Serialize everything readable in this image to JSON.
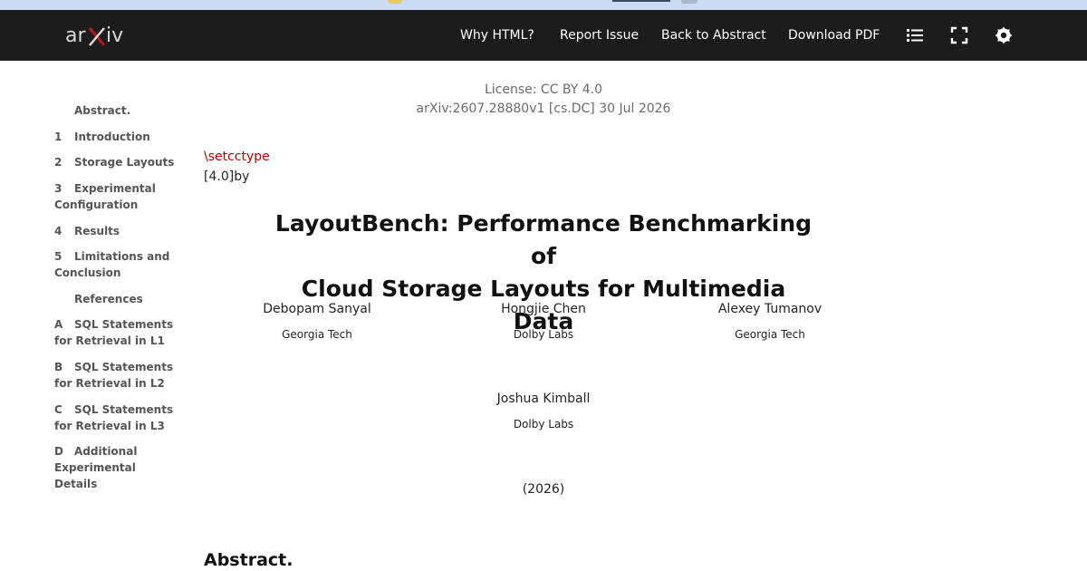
{
  "navbar": {
    "logo_alt": "arXiv",
    "links": [
      "Why HTML?",
      "Report Issue",
      "Back to Abstract",
      "Download PDF"
    ],
    "icons": [
      "list-icon",
      "fullscreen-icon",
      "theme-toggle-icon"
    ]
  },
  "toc": {
    "abstract": "Abstract.",
    "items": [
      {
        "num": "1",
        "label": "Introduction"
      },
      {
        "num": "2",
        "label": "Storage Layouts"
      },
      {
        "num": "3",
        "label": "Experimental Configuration"
      },
      {
        "num": "4",
        "label": "Results"
      },
      {
        "num": "5",
        "label": "Limitations and Conclusion"
      }
    ],
    "references": "References",
    "appendix": [
      {
        "num": "A",
        "label": "SQL Statements for Retrieval in L1"
      },
      {
        "num": "B",
        "label": "SQL Statements for Retrieval in L2"
      },
      {
        "num": "C",
        "label": "SQL Statements for Retrieval in L3"
      },
      {
        "num": "D",
        "label": "Additional Experimental Details"
      }
    ]
  },
  "paper": {
    "license": "License: CC BY 4.0",
    "arxiv_id": "arXiv:2607.28880v1 [cs.DC] 30 Jul 2026",
    "latex_cmd": "\\setcctype",
    "latex_arg": "[4.0]by",
    "title_line1": "LayoutBench: Performance Benchmarking of",
    "title_line2": "Cloud Storage Layouts for Multimedia Data",
    "authors": [
      {
        "name": "Debopam Sanyal",
        "affiliation": "Georgia Tech"
      },
      {
        "name": "Hongjie Chen",
        "affiliation": "Dolby Labs"
      },
      {
        "name": "Alexey Tumanov",
        "affiliation": "Georgia Tech"
      },
      {
        "name": "Joshua Kimball",
        "affiliation": "Dolby Labs"
      }
    ],
    "year": "(2026)",
    "abstract_heading": "Abstract."
  },
  "colors": {
    "navbar_bg": "#1c1c1c",
    "logo_red": "#b31b1b",
    "latex_red": "#b30000"
  }
}
